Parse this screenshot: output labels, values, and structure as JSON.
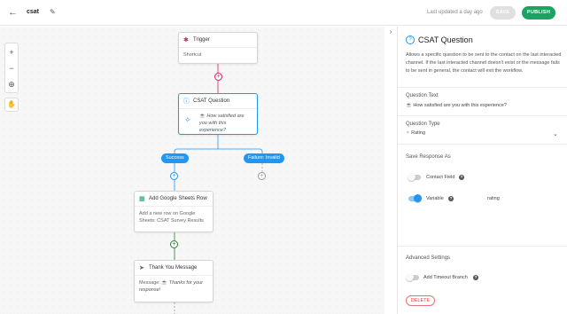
{
  "header": {
    "back_icon": "arrow-left-icon",
    "workflow_name": "csat",
    "edit_icon": "pencil-icon",
    "last_updated": "Last updated a day ago",
    "save_label": "SAVE",
    "publish_label": "PUBLISH",
    "publish_color": "#19a463"
  },
  "toolbar": {
    "zoom_in": "+",
    "zoom_out": "−",
    "fit": "target-icon",
    "pan": "hand-icon"
  },
  "nodes": {
    "trigger": {
      "title": "Trigger",
      "body": "Shortcut"
    },
    "csat": {
      "title": "CSAT Question",
      "body": "How satisfied are you with this experience?"
    },
    "success_label": "Success",
    "failure_label": "Failure: Invalid",
    "sheets": {
      "title": "Add Google Sheets Row",
      "body": "Add a new row on Google Sheets: CSAT Survey Results"
    },
    "thanks": {
      "title": "Thank You Message",
      "body_prefix": "Message:",
      "body": "Thanks for your response!"
    }
  },
  "panel": {
    "title": "CSAT Question",
    "description": "Allows a specific question to be sent to the contact on the last interacted channel. If the last interacted channel doesn't exist or the message fails to be sent in general, the contact will exit the workflow.",
    "question_text_label": "Question Text",
    "question_text_value": "How satisfied are you with this experience?",
    "question_type_label": "Question Type",
    "question_type_value": "Rating",
    "save_response_label": "Save Response As",
    "contact_field_label": "Contact Field",
    "contact_field_on": false,
    "variable_label": "Variable",
    "variable_on": true,
    "variable_value": "rating",
    "advanced_label": "Advanced Settings",
    "timeout_label": "Add Timeout Branch",
    "timeout_on": false,
    "delete_label": "DELETE"
  },
  "colors": {
    "accent": "#2196f3",
    "success": "#19a463",
    "danger": "#e53935"
  }
}
